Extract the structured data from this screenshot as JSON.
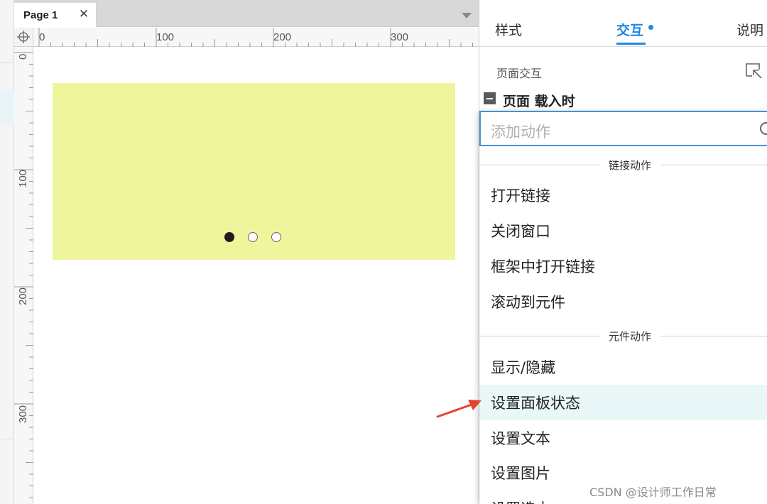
{
  "tab": {
    "label": "Page 1",
    "close_glyph": "✕"
  },
  "ruler": {
    "h_labels": [
      "0",
      "100",
      "200",
      "300"
    ],
    "v_labels": [
      "0",
      "100",
      "200",
      "300"
    ]
  },
  "carousel": {
    "dots_total": 3,
    "active_dot": 1,
    "fill_color": "#eff59c"
  },
  "panel": {
    "tabs": [
      {
        "label": "样式"
      },
      {
        "label": "交互"
      },
      {
        "label": "说明"
      }
    ],
    "active_tab": "交互",
    "section_label": "页面交互",
    "event_label": "页面 载入时",
    "search_placeholder": "添加动作",
    "groups": [
      {
        "title": "链接动作",
        "items": [
          "打开链接",
          "关闭窗口",
          "框架中打开链接",
          "滚动到元件"
        ]
      },
      {
        "title": "元件动作",
        "items": [
          "显示/隐藏",
          "设置面板状态",
          "设置文本",
          "设置图片",
          "设置选中"
        ]
      }
    ],
    "highlighted_item": "设置面板状态"
  },
  "annotation": {
    "arrow_color": "#e2452c",
    "icon": "red-arrow-icon"
  },
  "watermark": "CSDN @设计师工作日常",
  "colors": {
    "accent": "#1e88e5",
    "highlight": "#e9f7f9",
    "search_border": "#4a90d9"
  }
}
